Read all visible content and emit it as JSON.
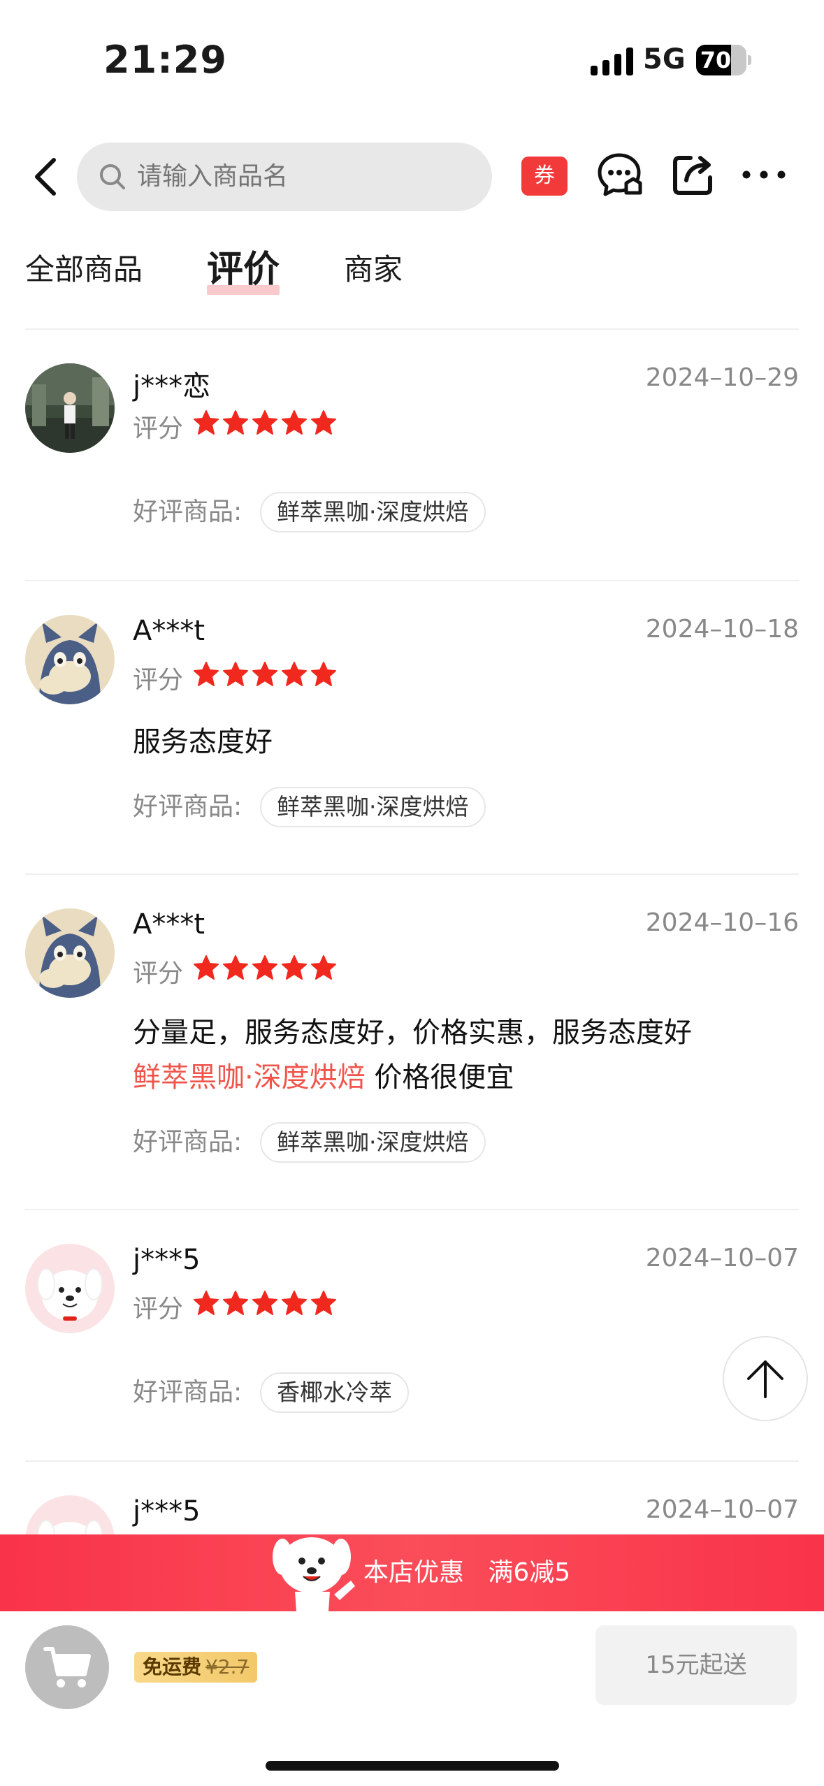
{
  "status_bar": {
    "time": "21:29",
    "network": "5G",
    "battery": "70",
    "battery_level": 0.7
  },
  "nav": {
    "search_placeholder": "请输入商品名",
    "coupon_label": "券"
  },
  "tabs": [
    {
      "label": "全部商品"
    },
    {
      "label": "评价"
    },
    {
      "label": "商家"
    }
  ],
  "reviews": [
    {
      "name": "j***恋",
      "date": "2024–10–29",
      "score_label": "评分",
      "rating": 5,
      "text": "",
      "goods_label": "好评商品:",
      "goods": "鲜萃黑咖·深度烘焙"
    },
    {
      "name": "A***t",
      "date": "2024–10–18",
      "score_label": "评分",
      "rating": 5,
      "text": "服务态度好",
      "goods_label": "好评商品:",
      "goods": "鲜萃黑咖·深度烘焙"
    },
    {
      "name": "A***t",
      "date": "2024–10–16",
      "score_label": "评分",
      "rating": 5,
      "text": "分量足，服务态度好，价格实惠，服务态度好",
      "text_highlight": "鲜萃黑咖·深度烘焙",
      "text_tail": " 价格很便宜",
      "goods_label": "好评商品:",
      "goods": "鲜萃黑咖·深度烘焙"
    },
    {
      "name": "j***5",
      "date": "2024–10–07",
      "score_label": "评分",
      "rating": 5,
      "text": "",
      "goods_label": "好评商品:",
      "goods": "香椰水冷萃"
    },
    {
      "name": "j***5",
      "date": "2024–10–07"
    }
  ],
  "promo": {
    "label": "本店优惠",
    "offer": "满6减5"
  },
  "bottom_bar": {
    "free_shipping": "免运费",
    "old_fee": "¥2.7",
    "min_order": "15元起送"
  },
  "colors": {
    "accent": "#f33a3a",
    "star": "#f0281e",
    "highlight": "#f0544a",
    "promo_bg": "#f9334a"
  }
}
